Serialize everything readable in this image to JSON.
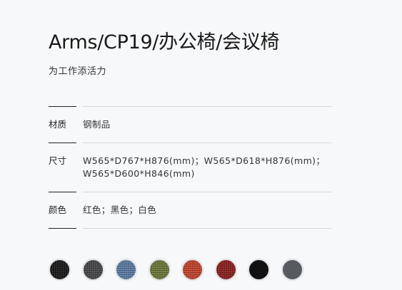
{
  "product": {
    "title": "Arms/CP19/办公椅/会议椅",
    "tagline": "为工作添活力"
  },
  "specs": [
    {
      "label": "材质",
      "value": "钢制品"
    },
    {
      "label": "尺寸",
      "value": "W565*D767*H876(mm)；W565*D618*H876(mm)；W565*D600*H846(mm)"
    },
    {
      "label": "颜色",
      "value": "红色；黑色；白色"
    }
  ],
  "swatches": [
    {
      "name": "black-mesh",
      "color": "#1c1c1c"
    },
    {
      "name": "grey-mesh",
      "color": "#4a4a4c"
    },
    {
      "name": "blue-mesh",
      "color": "#5f7ea6"
    },
    {
      "name": "olive-mesh",
      "color": "#6f7b3c"
    },
    {
      "name": "orange-red-mesh",
      "color": "#c4472f"
    },
    {
      "name": "dark-red-mesh",
      "color": "#8e2222"
    },
    {
      "name": "solid-black",
      "color": "#111111"
    },
    {
      "name": "slate-grey",
      "color": "#575b60"
    }
  ]
}
